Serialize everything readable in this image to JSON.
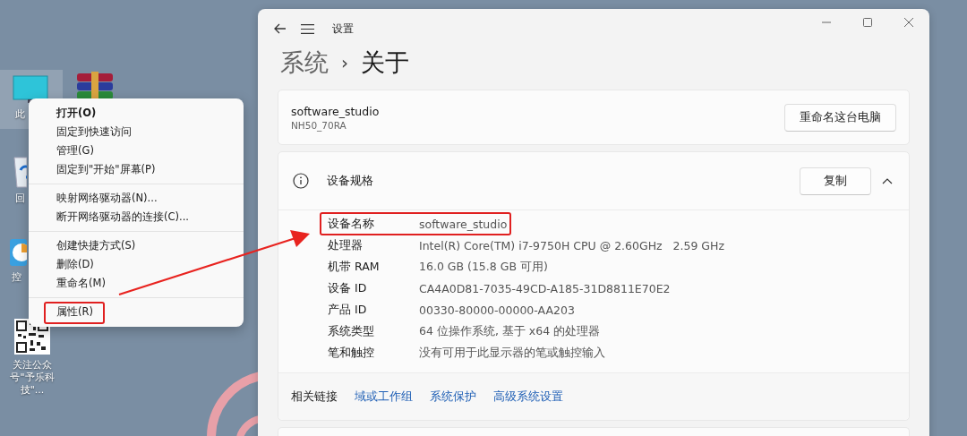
{
  "desktop": {
    "icons": [
      {
        "kind": "monitor",
        "label": "此"
      },
      {
        "kind": "archive"
      },
      {
        "kind": "recycle",
        "label": "回"
      },
      {
        "kind": "control",
        "label": "控"
      },
      {
        "kind": "qr",
        "label": "关注公众号\"予乐科技\"..."
      }
    ]
  },
  "context_menu": {
    "groups": [
      [
        {
          "label": "打开(O)",
          "kind": "default",
          "highlighted": false
        },
        {
          "label": "固定到快速访问",
          "kind": "normal",
          "highlighted": false
        },
        {
          "label": "管理(G)",
          "kind": "normal",
          "highlighted": false
        },
        {
          "label": "固定到\"开始\"屏幕(P)",
          "kind": "normal",
          "highlighted": false
        }
      ],
      [
        {
          "label": "映射网络驱动器(N)...",
          "kind": "normal",
          "highlighted": false
        },
        {
          "label": "断开网络驱动器的连接(C)...",
          "kind": "normal",
          "highlighted": false
        }
      ],
      [
        {
          "label": "创建快捷方式(S)",
          "kind": "normal",
          "highlighted": false
        },
        {
          "label": "删除(D)",
          "kind": "normal",
          "highlighted": false
        },
        {
          "label": "重命名(M)",
          "kind": "normal",
          "highlighted": false
        }
      ],
      [
        {
          "label": "属性(R)",
          "kind": "normal",
          "highlighted": true
        }
      ]
    ]
  },
  "window": {
    "title": "设置",
    "breadcrumb": [
      "系统",
      "›",
      "关于"
    ],
    "device": {
      "name": "software_studio",
      "model": "NH50_70RA",
      "rename_button": "重命名这台电脑"
    },
    "specs": {
      "title": "设备规格",
      "copy_button": "复制",
      "expanded": true,
      "rows": [
        {
          "label": "设备名称",
          "value": "software_studio",
          "highlighted": true
        },
        {
          "label": "处理器",
          "value": "Intel(R) Core(TM) i7-9750H CPU @ 2.60GHz   2.59 GHz",
          "highlighted": false
        },
        {
          "label": "机带 RAM",
          "value": "16.0 GB (15.8 GB 可用)",
          "highlighted": false
        },
        {
          "label": "设备 ID",
          "value": "CA4A0D81-7035-49CD-A185-31D8811E70E2",
          "highlighted": false
        },
        {
          "label": "产品 ID",
          "value": "00330-80000-00000-AA203",
          "highlighted": false
        },
        {
          "label": "系统类型",
          "value": "64 位操作系统, 基于 x64 的处理器",
          "highlighted": false
        },
        {
          "label": "笔和触控",
          "value": "没有可用于此显示器的笔或触控输入",
          "highlighted": false
        }
      ],
      "related_label": "相关链接",
      "related_links": [
        "域或工作组",
        "系统保护",
        "高级系统设置"
      ]
    }
  }
}
